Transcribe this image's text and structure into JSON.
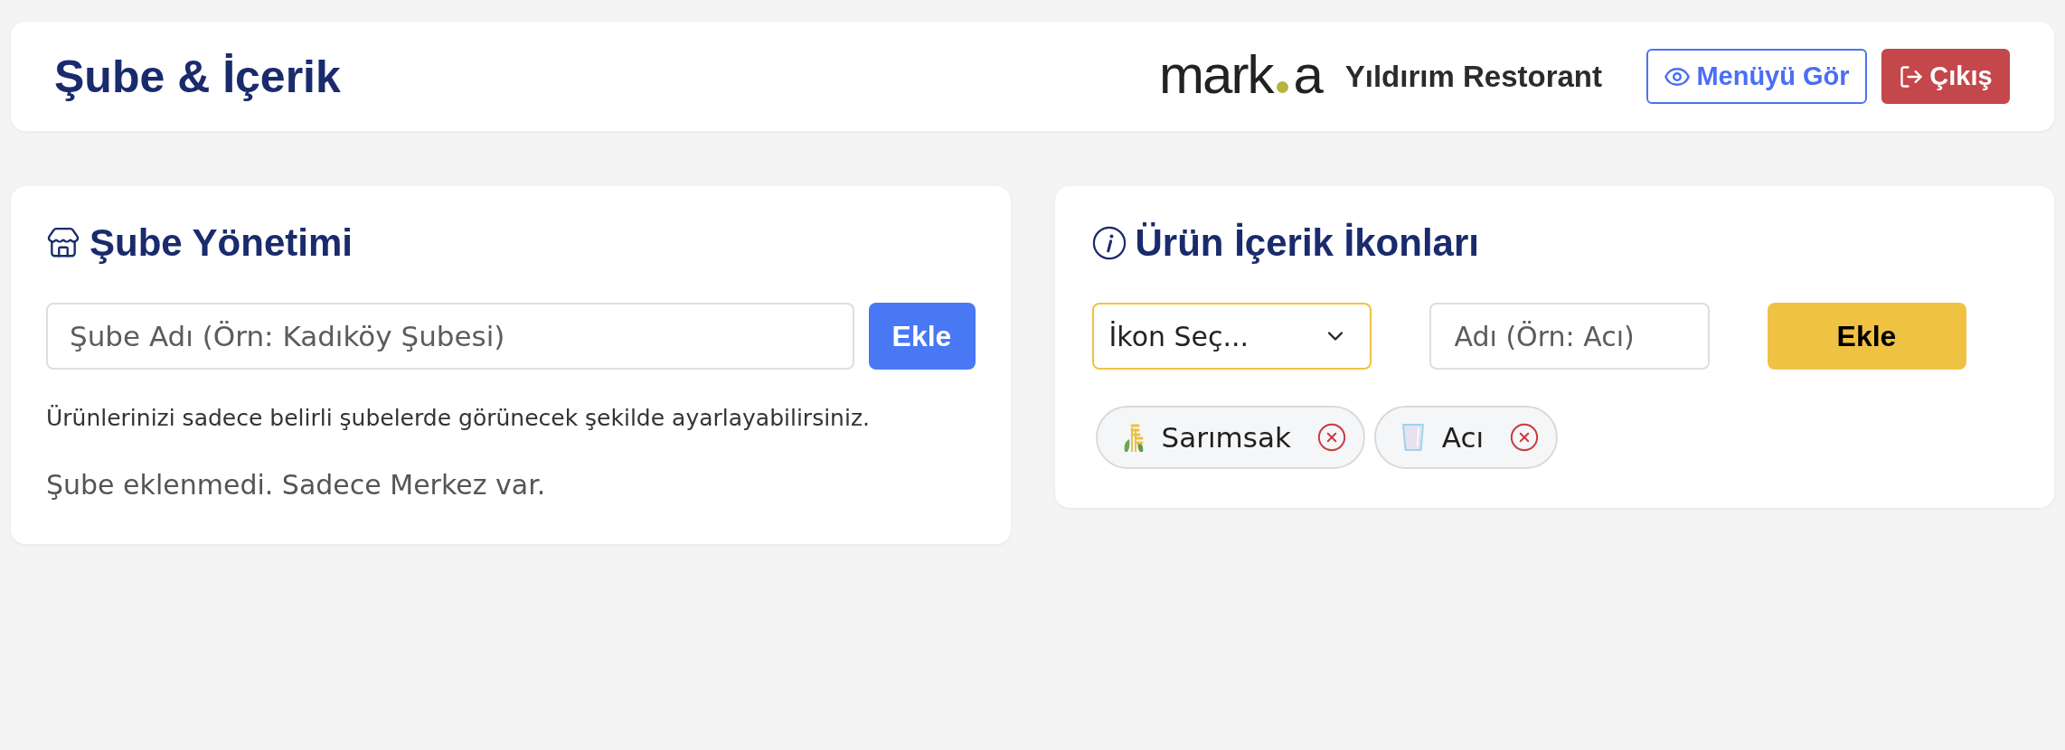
{
  "header": {
    "title": "Şube & İçerik",
    "logo": {
      "left": "mark",
      "right": "a"
    },
    "restaurant_name": "Yıldırım Restorant",
    "buttons": [
      {
        "label": "Menüyü Gör",
        "kind": "outline"
      },
      {
        "label": "Çıkış",
        "kind": "danger"
      }
    ]
  },
  "branch_panel": {
    "title": "Şube Yönetimi",
    "name_input": {
      "placeholder": "Şube Adı (Örn: Kadıköy Şubesi)"
    },
    "add_button": "Ekle",
    "hint": "Ürünlerinizi sadece belirli şubelerde görünecek şekilde ayarlayabilirsiniz.",
    "empty_message": "Şube eklenmedi. Sadece Merkez var."
  },
  "icons_panel": {
    "title": "Ürün İçerik İkonları",
    "icon_select": {
      "value": "İkon Seç..."
    },
    "name_input": {
      "placeholder": "Adı (Örn: Acı)"
    },
    "add_button": "Ekle",
    "tags": [
      {
        "label": "Sarımsak",
        "kind": "grain"
      },
      {
        "label": "Acı",
        "kind": "drink"
      }
    ]
  }
}
